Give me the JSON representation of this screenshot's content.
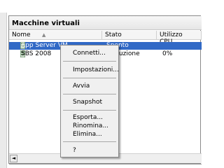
{
  "panel": {
    "title": "Macchine virtuali",
    "columns": [
      "Nome",
      "Stato",
      "Utilizzo CPU"
    ],
    "sort_indicator": "▲",
    "rows": [
      {
        "name": "App Server VM",
        "state": "Spento",
        "cpu": ""
      },
      {
        "name": "SBS 2008",
        "state": "In esecuzione",
        "cpu": "0%"
      }
    ],
    "scroll_left": "◄"
  },
  "context_menu": {
    "items": [
      "Connetti...",
      "Impostazioni...",
      "Avvia",
      "Snapshot",
      "Esporta...",
      "Rinomina...",
      "Elimina...",
      "?"
    ]
  },
  "colors": {
    "selection": "#3169c6",
    "menu_bg": "#f0f0f0"
  }
}
